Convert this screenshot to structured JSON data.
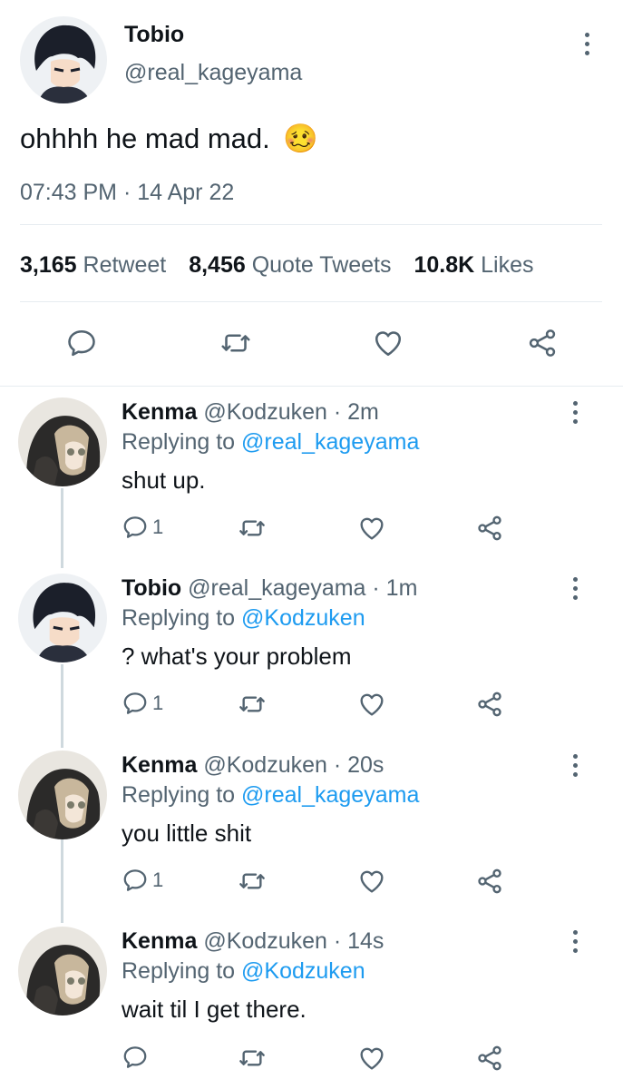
{
  "main_tweet": {
    "display_name": "Tobio",
    "handle": "@real_kageyama",
    "text": "ohhhh he mad mad.",
    "emoji": "🥴",
    "timestamp": "07:43 PM · 14 Apr 22",
    "stats": {
      "retweets_count": "3,165",
      "retweets_label": "Retweet",
      "quotes_count": "8,456",
      "quotes_label": "Quote Tweets",
      "likes_count": "10.8K",
      "likes_label": "Likes"
    },
    "actions": [
      "reply-icon",
      "retweet-icon",
      "like-icon",
      "share-icon"
    ]
  },
  "replies": [
    {
      "display_name": "Kenma",
      "handle_time": "@Kodzuken · 2m",
      "replying_label": "Replying to",
      "replying_to": "@real_kageyama",
      "text": "shut up.",
      "reply_count": "1"
    },
    {
      "display_name": "Tobio",
      "handle_time": "@real_kageyama · 1m",
      "replying_label": "Replying to",
      "replying_to": "@Kodzuken",
      "text": "? what's your problem",
      "reply_count": "1"
    },
    {
      "display_name": "Kenma",
      "handle_time": "@Kodzuken · 20s",
      "replying_label": "Replying to",
      "replying_to": "@real_kageyama",
      "text": "you little shit",
      "reply_count": "1"
    },
    {
      "display_name": "Kenma",
      "handle_time": "@Kodzuken · 14s",
      "replying_label": "Replying to",
      "replying_to": "@Kodzuken",
      "text": "wait til I get there.",
      "reply_count": ""
    }
  ],
  "colors": {
    "text": "#0f1419",
    "muted": "#536471",
    "link": "#1d9bf0",
    "divider": "#e6ecf0"
  }
}
